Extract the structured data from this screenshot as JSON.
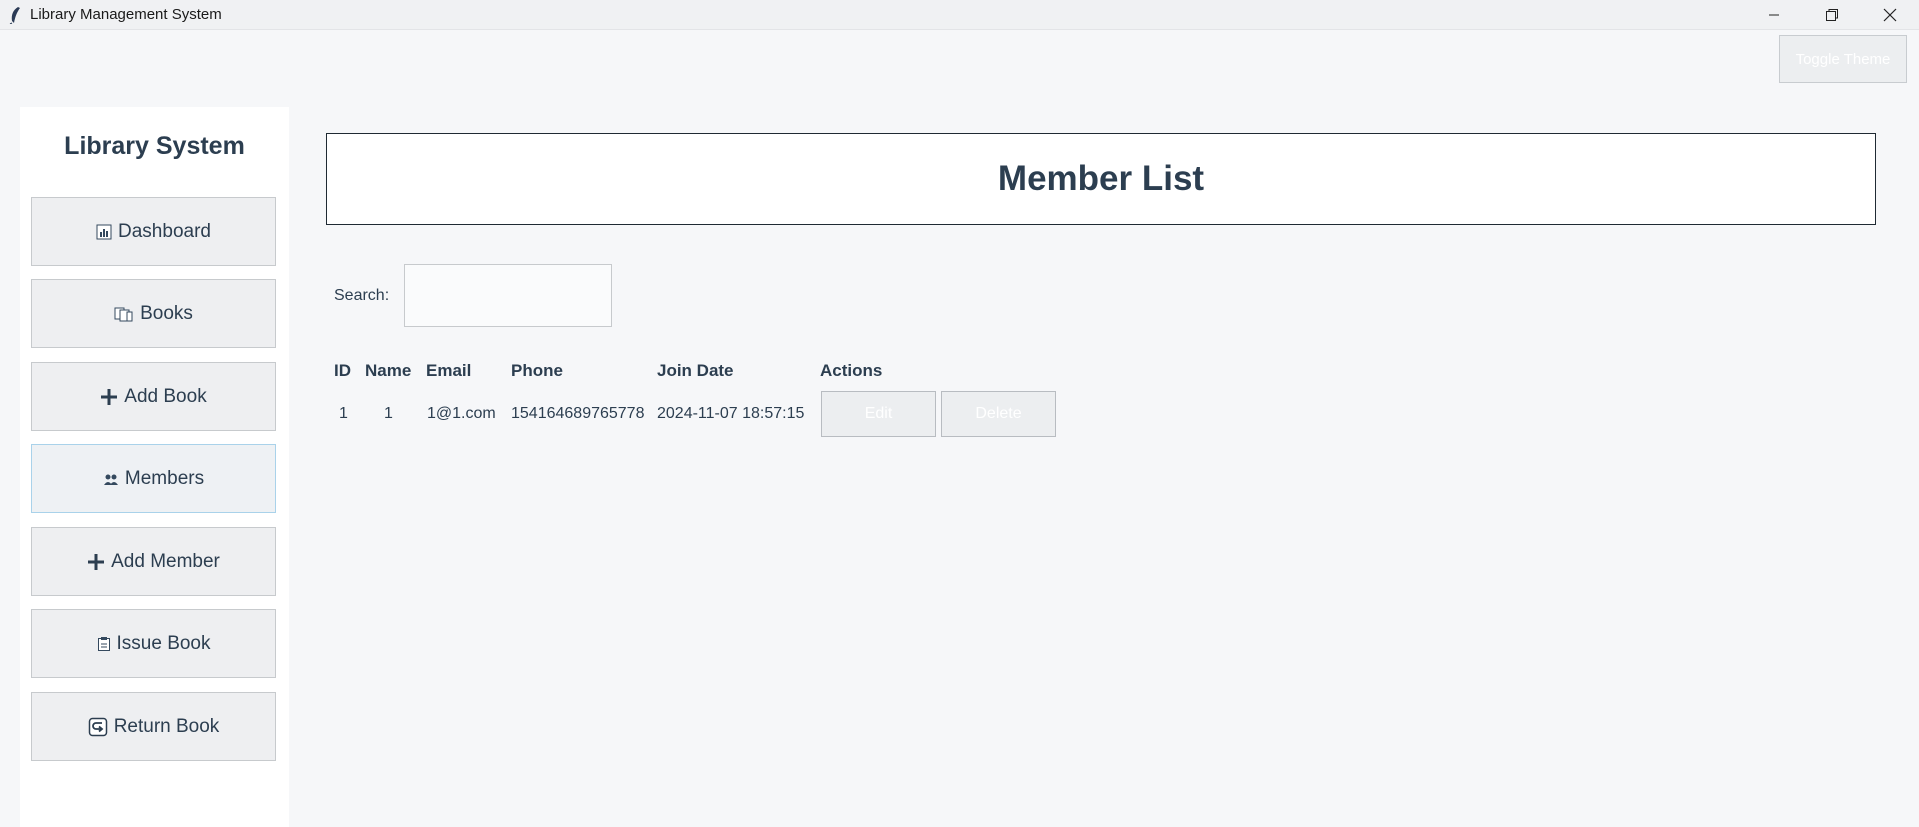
{
  "window": {
    "title": "Library Management System"
  },
  "toolbar": {
    "toggle_theme_label": "Toggle Theme"
  },
  "sidebar": {
    "title": "Library System",
    "items": [
      {
        "label": "Dashboard",
        "icon": "bar-chart-icon"
      },
      {
        "label": "Books",
        "icon": "books-icon"
      },
      {
        "label": "Add Book",
        "icon": "plus-icon"
      },
      {
        "label": "Members",
        "icon": "members-icon",
        "active": true
      },
      {
        "label": "Add Member",
        "icon": "plus-icon"
      },
      {
        "label": "Issue Book",
        "icon": "clipboard-icon"
      },
      {
        "label": "Return Book",
        "icon": "return-icon"
      }
    ]
  },
  "main": {
    "title": "Member List",
    "search": {
      "label": "Search:",
      "value": "",
      "placeholder": ""
    },
    "table": {
      "headers": [
        "ID",
        "Name",
        "Email",
        "Phone",
        "Join Date",
        "Actions"
      ],
      "rows": [
        {
          "id": "1",
          "name": "1",
          "email": "1@1.com",
          "phone": "154164689765778",
          "join_date": "2024-11-07 18:57:15",
          "edit_label": "Edit",
          "delete_label": "Delete"
        }
      ]
    }
  },
  "colors": {
    "text": "#2c3e50",
    "active_border": "#a9d2ea",
    "page_background": "#f6f7f9"
  }
}
